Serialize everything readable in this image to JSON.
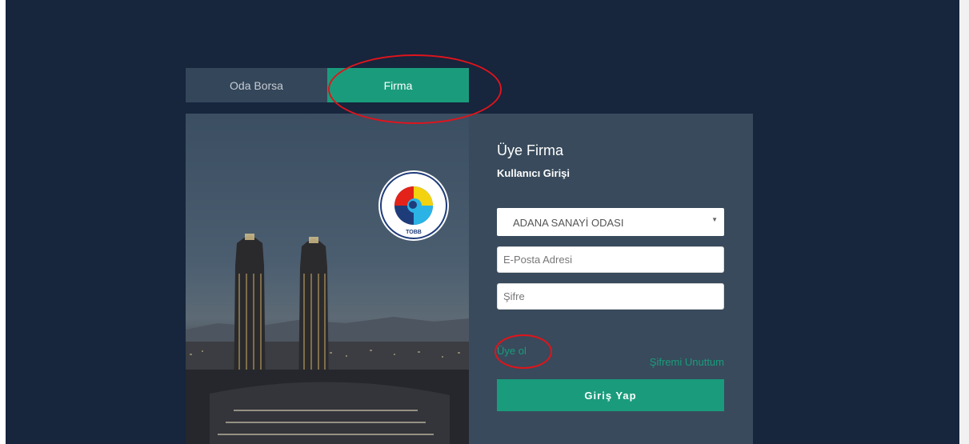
{
  "tabs": [
    {
      "label": "Oda Borsa",
      "active": false
    },
    {
      "label": "Firma",
      "active": true
    }
  ],
  "logo": {
    "text_ring": "TÜRKİYE ODALAR VE BORSALAR BİRLİĞİ",
    "abbr": "TOBB"
  },
  "form": {
    "title": "Üye Firma",
    "subtitle": "Kullanıcı Girişi",
    "chamber_select": {
      "value": "ADANA SANAYİ ODASI"
    },
    "email": {
      "placeholder": "E-Posta Adresi",
      "value": ""
    },
    "password": {
      "placeholder": "Şifre",
      "value": ""
    },
    "register_label": "Üye ol",
    "forgot_label": "Şifremi Unuttum",
    "login_label": "Giriş Yap"
  },
  "icons": {
    "select_arrow": "caret-down-icon"
  },
  "colors": {
    "page_bg": "#17253d",
    "card_bg": "#384a5b",
    "accent": "#1a9c7c",
    "tab_inactive": "#34465a",
    "annotation": "#e0141b"
  }
}
